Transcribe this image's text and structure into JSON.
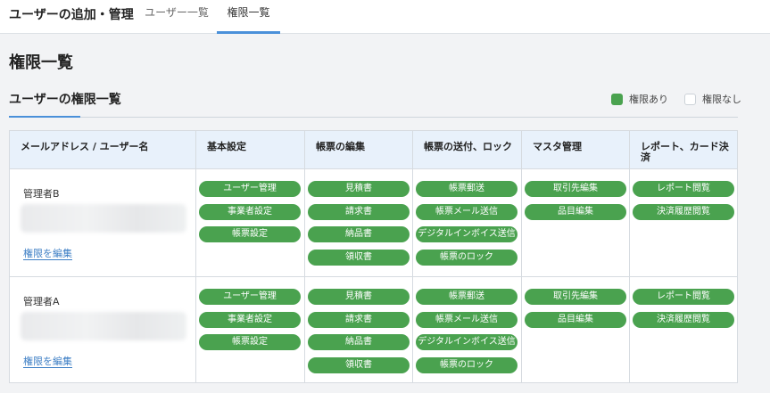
{
  "header": {
    "app_title": "ユーザーの追加・管理",
    "tabs": [
      {
        "label": "ユーザー一覧",
        "active": false
      },
      {
        "label": "権限一覧",
        "active": true
      }
    ]
  },
  "page": {
    "title": "権限一覧",
    "section_title": "ユーザーの権限一覧"
  },
  "legend": {
    "granted": "権限あり",
    "not_granted": "権限なし"
  },
  "colors": {
    "accent": "#4a90d9",
    "granted": "#4aa24f",
    "header_bg": "#e8f1fb",
    "link": "#3b7dc4"
  },
  "table": {
    "headers": [
      "メールアドレス / ユーザー名",
      "基本設定",
      "帳票の編集",
      "帳票の送付、ロック",
      "マスタ管理",
      "レポート、カード決済"
    ],
    "rows": [
      {
        "name": "管理者B",
        "edit_label": "権限を編集",
        "basic": [
          "ユーザー管理",
          "事業者設定",
          "帳票設定"
        ],
        "edit": [
          "見積書",
          "請求書",
          "納品書",
          "領収書"
        ],
        "send": [
          "帳票郵送",
          "帳票メール送信",
          "デジタルインボイス送信",
          "帳票のロック"
        ],
        "master": [
          "取引先編集",
          "品目編集"
        ],
        "report": [
          "レポート閲覧",
          "決済履歴閲覧"
        ]
      },
      {
        "name": "管理者A",
        "edit_label": "権限を編集",
        "basic": [
          "ユーザー管理",
          "事業者設定",
          "帳票設定"
        ],
        "edit": [
          "見積書",
          "請求書",
          "納品書",
          "領収書"
        ],
        "send": [
          "帳票郵送",
          "帳票メール送信",
          "デジタルインボイス送信",
          "帳票のロック"
        ],
        "master": [
          "取引先編集",
          "品目編集"
        ],
        "report": [
          "レポート閲覧",
          "決済履歴閲覧"
        ]
      }
    ]
  }
}
